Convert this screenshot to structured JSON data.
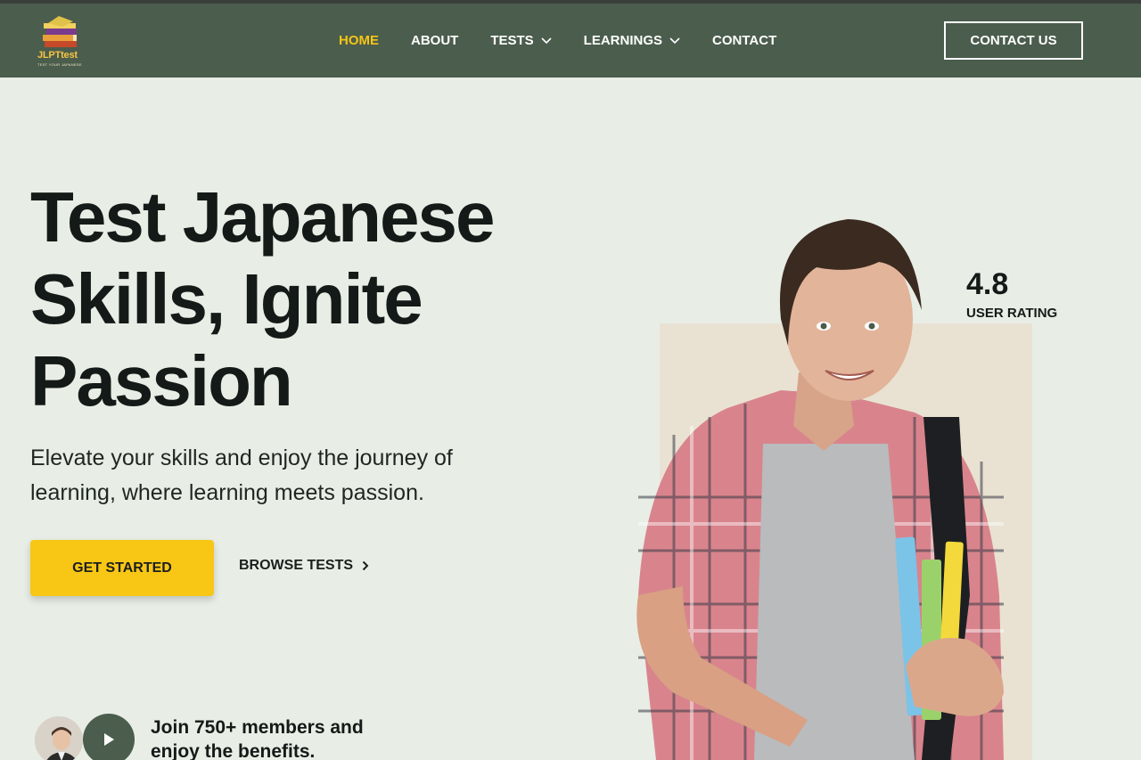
{
  "brand": {
    "name": "JLPTtest",
    "tagline": "TEST YOUR JAPANESE"
  },
  "nav": {
    "items": [
      {
        "label": "HOME",
        "active": true,
        "dropdown": false
      },
      {
        "label": "ABOUT",
        "active": false,
        "dropdown": false
      },
      {
        "label": "TESTS",
        "active": false,
        "dropdown": true
      },
      {
        "label": "LEARNINGS",
        "active": false,
        "dropdown": true
      },
      {
        "label": "CONTACT",
        "active": false,
        "dropdown": false
      }
    ],
    "cta": "CONTACT US"
  },
  "hero": {
    "title_line1": "Test Japanese",
    "title_line2": "Skills, Ignite",
    "title_line3": "Passion",
    "description": "Elevate your skills and enjoy the journey of learning, where learning meets passion.",
    "primary_cta": "GET STARTED",
    "secondary_cta": "BROWSE TESTS"
  },
  "community": {
    "text": "Join 750+ members and enjoy the benefits."
  },
  "rating": {
    "value": "4.8",
    "label": "USER RATING"
  },
  "colors": {
    "header_bg": "#4b5d4c",
    "accent": "#f8c615",
    "page_bg": "#e8ede6"
  }
}
